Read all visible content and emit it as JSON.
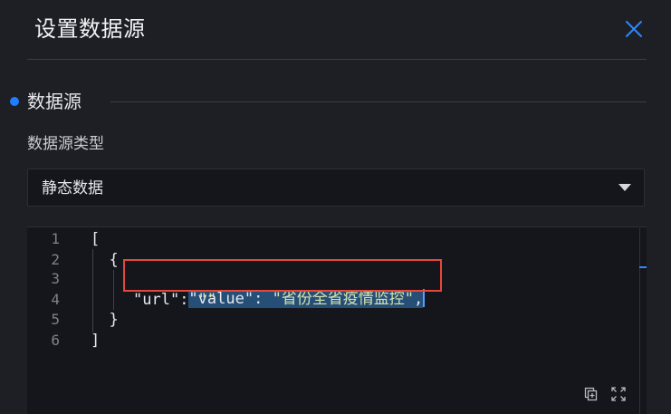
{
  "header": {
    "title": "设置数据源",
    "close_icon": "close-icon"
  },
  "section": {
    "title": "数据源",
    "accent_color": "#1f7dff"
  },
  "datasource_type": {
    "label": "数据源类型",
    "value": "静态数据",
    "icon": "caret-down-icon"
  },
  "editor": {
    "lines": [
      {
        "number": "1",
        "text": "["
      },
      {
        "number": "2",
        "text": "  {"
      },
      {
        "number": "3",
        "key": "\"value\"",
        "colon": ": ",
        "value": "\"省份全省疫情监控\"",
        "tail": ","
      },
      {
        "number": "4",
        "key": "\"url\"",
        "colon": ": ",
        "value": "\"\"",
        "tail": ""
      },
      {
        "number": "5",
        "text": "  }"
      },
      {
        "number": "6",
        "text": "]"
      }
    ],
    "tools": [
      "copy-icon",
      "fullscreen-icon"
    ]
  },
  "highlight_color": "#e5483a"
}
